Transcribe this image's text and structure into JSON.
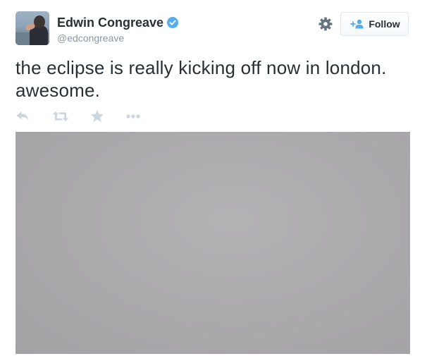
{
  "author": {
    "name": "Edwin Congreave",
    "handle": "@edcongreave",
    "verified": true
  },
  "follow_button": {
    "label": "Follow"
  },
  "tweet": {
    "text": "the eclipse is really kicking off now in london. awesome."
  },
  "actions": [
    "reply-icon",
    "retweet-icon",
    "favorite-icon",
    "more-icon"
  ],
  "icons": {
    "settings": "gear-icon",
    "verified": "verified-badge-icon",
    "follow": "add-user-icon"
  },
  "colors": {
    "text": "#292f33",
    "muted": "#8899a6",
    "verified": "#55acee",
    "action_icons": "#ccd6dd",
    "photo": "#acabae"
  }
}
